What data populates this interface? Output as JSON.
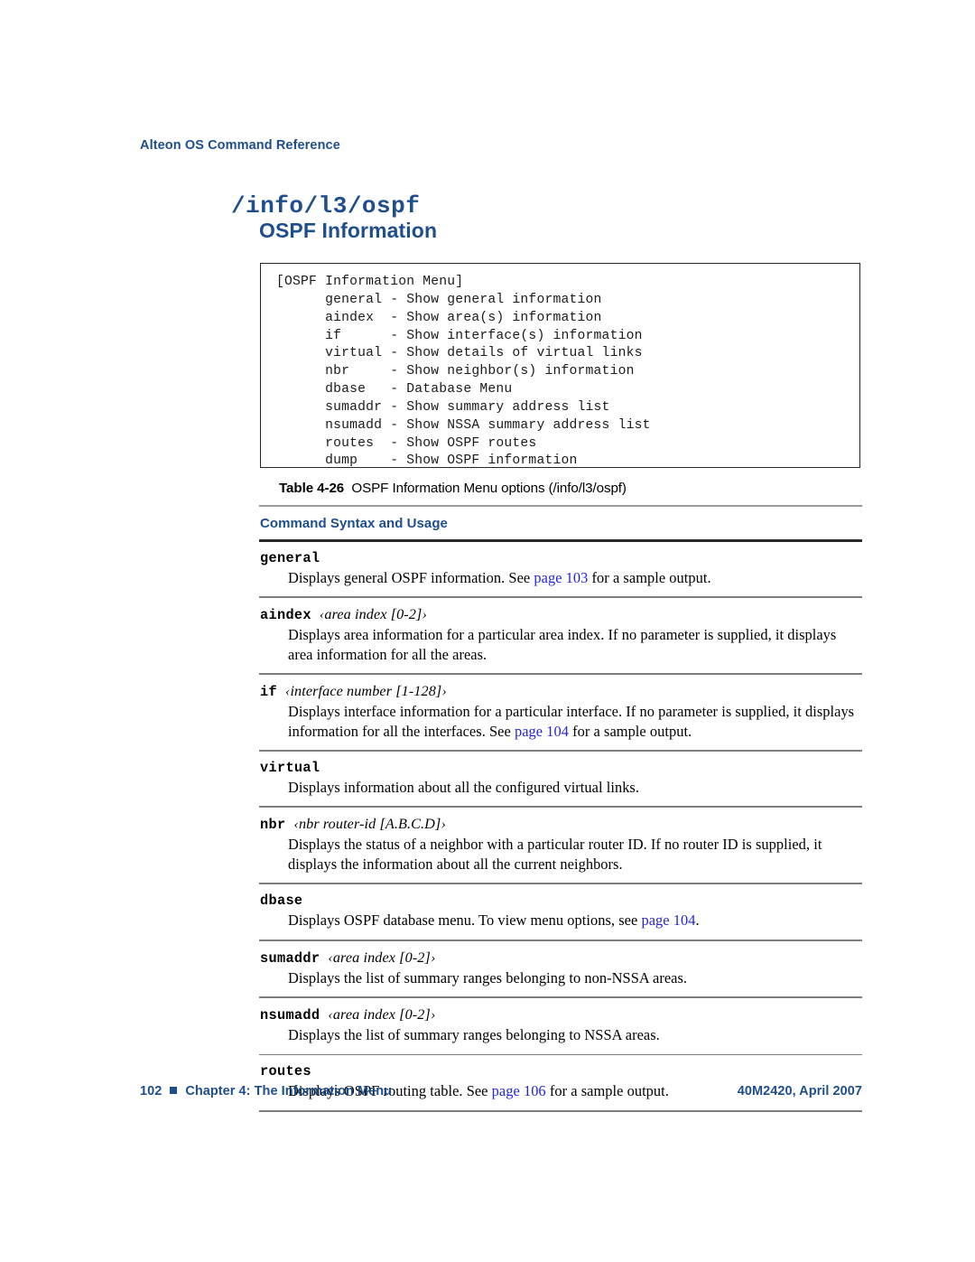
{
  "running_head": "Alteon OS Command Reference",
  "title": {
    "path": "/info/l3/ospf",
    "name": "OSPF Information"
  },
  "code_block": {
    "content": "[OSPF Information Menu]\n      general - Show general information\n      aindex  - Show area(s) information\n      if      - Show interface(s) information\n      virtual - Show details of virtual links\n      nbr     - Show neighbor(s) information\n      dbase   - Database Menu\n      sumaddr - Show summary address list\n      nsumadd - Show NSSA summary address list\n      routes  - Show OSPF routes\n      dump    - Show OSPF information"
  },
  "table": {
    "caption_label": "Table 4-26",
    "caption_text": "OSPF Information Menu options (/info/l3/ospf)",
    "header": "Command Syntax and Usage",
    "rows": [
      {
        "command": "general",
        "param": "",
        "desc_pre": "Displays general OSPF information. See ",
        "link": "page 103",
        "desc_post": " for a sample output."
      },
      {
        "command": "aindex",
        "param": "‹area index [0-2]›",
        "desc_pre": "Displays area information for a particular area index. If no parameter is supplied, it displays area information for all the areas.",
        "link": "",
        "desc_post": ""
      },
      {
        "command": "if",
        "param": "‹interface number [1-128]›",
        "desc_pre": "Displays interface information for a particular interface. If no parameter is supplied, it displays information for all the interfaces. See ",
        "link": "page 104",
        "desc_post": " for a sample output."
      },
      {
        "command": "virtual",
        "param": "",
        "desc_pre": "Displays information about all the configured virtual links.",
        "link": "",
        "desc_post": ""
      },
      {
        "command": "nbr",
        "param": "‹nbr router-id [A.B.C.D]›",
        "desc_pre": "Displays the status of a neighbor with a particular router ID. If no router ID is supplied, it displays the information about all the current neighbors.",
        "link": "",
        "desc_post": ""
      },
      {
        "command": "dbase",
        "param": "",
        "desc_pre": "Displays OSPF database menu. To view menu options, see ",
        "link": "page 104",
        "desc_post": "."
      },
      {
        "command": "sumaddr",
        "param": "‹area index [0-2]›",
        "desc_pre": "Displays the list of summary ranges belonging to non-NSSA areas.",
        "link": "",
        "desc_post": ""
      },
      {
        "command": "nsumadd",
        "param": "‹area index [0-2]›",
        "desc_pre": "Displays the list of summary ranges belonging to NSSA areas.",
        "link": "",
        "desc_post": ""
      },
      {
        "command": "routes",
        "param": "",
        "desc_pre": "Displays OSPF routing table. See ",
        "link": "page 106",
        "desc_post": " for a sample output."
      }
    ]
  },
  "footer": {
    "page_number": "102",
    "chapter": "Chapter 4:  The Information Menu",
    "doc_id": "40M2420, April 2007"
  },
  "colors": {
    "brand_navy": "#1f4e8c",
    "link_blue": "#2424dd",
    "rule_gray": "#9a9a9a",
    "rule_dark": "#2b2b2b"
  }
}
